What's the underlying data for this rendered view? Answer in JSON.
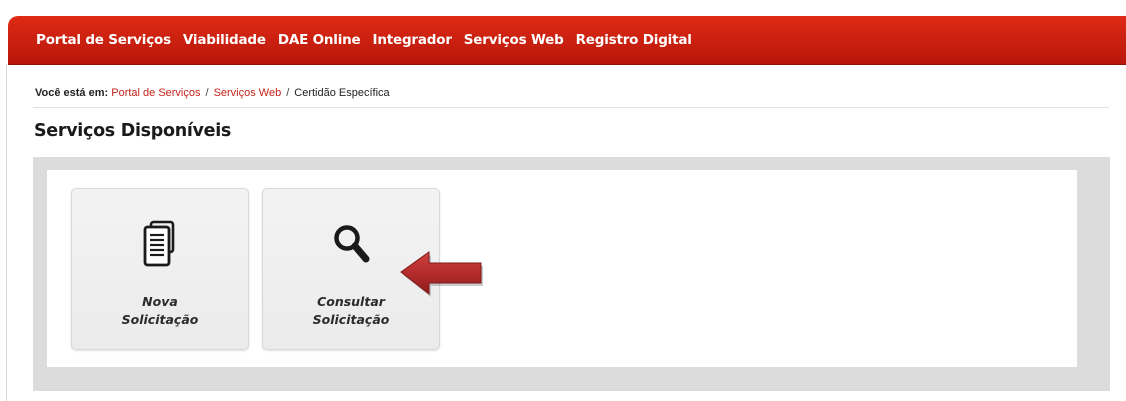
{
  "nav": {
    "items": [
      {
        "label": "Portal de Serviços"
      },
      {
        "label": "Viabilidade"
      },
      {
        "label": "DAE Online"
      },
      {
        "label": "Integrador"
      },
      {
        "label": "Serviços Web"
      },
      {
        "label": "Registro Digital"
      }
    ]
  },
  "breadcrumb": {
    "lead": "Você está em:",
    "items": [
      {
        "label": "Portal de Serviços"
      },
      {
        "label": "Serviços Web"
      },
      {
        "label": "Certidão Específica"
      }
    ],
    "separator": "/"
  },
  "section": {
    "title": "Serviços Disponíveis"
  },
  "tiles": [
    {
      "line1": "Nova",
      "line2": "Solicitação",
      "icon": "document-icon"
    },
    {
      "line1": "Consultar",
      "line2": "Solicitação",
      "icon": "search-icon"
    }
  ],
  "annotation": {
    "icon": "pointer-arrow-icon",
    "color": "#b22a2a"
  },
  "colors": {
    "brand_red": "#c9200f",
    "link_red": "#c4231a",
    "panel_gray": "#dcdcdc"
  }
}
